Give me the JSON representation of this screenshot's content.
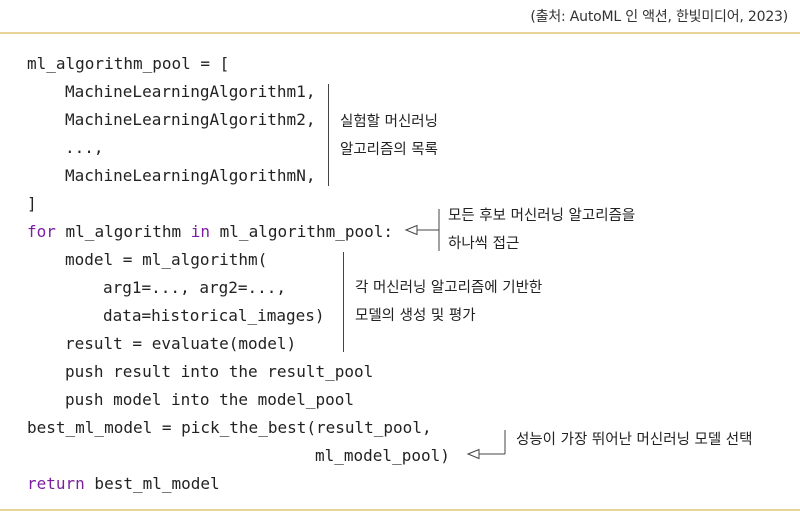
{
  "source_caption": "(출처: AutoML 인 액션, 한빛미디어, 2023)",
  "code": {
    "line1": "ml_algorithm_pool = [",
    "line2": "MachineLearningAlgorithm1,",
    "line3": "MachineLearningAlgorithm2,",
    "line4": "...,",
    "line5": "MachineLearningAlgorithmN,",
    "line6": "]",
    "line7_kw_for": "for",
    "line7_var": " ml_algorithm ",
    "line7_kw_in": "in",
    "line7_rest": " ml_algorithm_pool:",
    "line8": "model = ml_algorithm(",
    "line9": "arg1=..., arg2=...,",
    "line10": "data=historical_images)",
    "line11": "result = evaluate(model)",
    "line12": "push result into the result_pool",
    "line13": "push model into the model_pool",
    "line14": "best_ml_model = pick_the_best(result_pool,",
    "line15": "ml_model_pool)",
    "line16_kw_return": "return",
    "line16_rest": " best_ml_model"
  },
  "annotations": {
    "pool": [
      "실험할 머신러닝",
      "알고리즘의 목록"
    ],
    "loop": [
      "모든 후보 머신러닝 알고리즘을",
      "하나씩 접근"
    ],
    "build": [
      "각 머신러닝 알고리즘에 기반한",
      "모델의 생성 및 평가"
    ],
    "best": [
      "성능이 가장 뛰어난 머신러닝 모델 선택"
    ]
  },
  "colors": {
    "keyword": "#7b1fa2",
    "rule": "#e8d49a",
    "text": "#222222"
  }
}
